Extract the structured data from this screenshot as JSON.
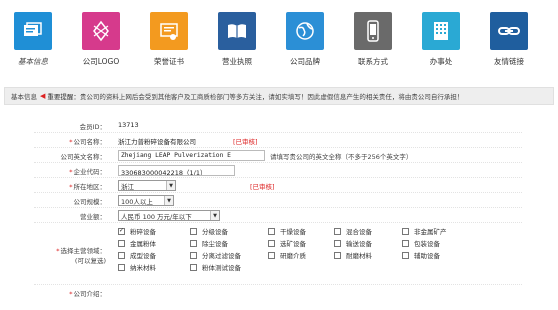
{
  "nav": [
    {
      "label": "基本信息",
      "color": "#1f8fd6",
      "icon": "profile-card-icon",
      "active": true
    },
    {
      "label": "公司LOGO",
      "color": "#d63a8c",
      "icon": "logo-shape-icon",
      "active": false
    },
    {
      "label": "荣誉证书",
      "color": "#f39a1f",
      "icon": "certificate-icon",
      "active": false
    },
    {
      "label": "营业执照",
      "color": "#2a5f9e",
      "icon": "license-book-icon",
      "active": false
    },
    {
      "label": "公司品牌",
      "color": "#2b8fd6",
      "icon": "globe-icon",
      "active": false
    },
    {
      "label": "联系方式",
      "color": "#6a6a6a",
      "icon": "phone-icon",
      "active": false
    },
    {
      "label": "办事处",
      "color": "#2aa9d4",
      "icon": "building-icon",
      "active": false
    },
    {
      "label": "友情链接",
      "color": "#1f5e9e",
      "icon": "link-icon",
      "active": false
    }
  ],
  "notice": {
    "prefix": "基本信息",
    "bold": "重要提醒：",
    "text": "贵公司的资料上网后会受到其他客户及工商质检部门等多方关注，请如实填写！因此虚假信息产生的相关责任，将由贵公司自行承担！"
  },
  "form": {
    "member_id": {
      "label": "会员ID：",
      "value": "13713"
    },
    "company_name": {
      "label": "公司名称：",
      "value": "浙江力普粉碎设备有限公司",
      "status": "[已审核]"
    },
    "english_name": {
      "label": "公司英文名称：",
      "value": "Zhejiang LEAP Pulverization E",
      "hint": "请填写贵公司的英文全称（不多于256个英文字）"
    },
    "enterprise_code": {
      "label": "企业代码：",
      "value": "330683000042218（1/1）"
    },
    "region": {
      "label": "所在地区：",
      "value": "浙江",
      "status": "[已审核]"
    },
    "scale": {
      "label": "公司规模：",
      "value": "100人以上"
    },
    "revenue": {
      "label": "营业额：",
      "value": "人民币 100 万元/年以下"
    },
    "main_industry": {
      "label": "选择主营领域：",
      "sublabel": "(可以复选)",
      "options": [
        {
          "label": "粉碎设备",
          "checked": true
        },
        {
          "label": "分级设备",
          "checked": false
        },
        {
          "label": "干燥设备",
          "checked": false
        },
        {
          "label": "混合设备",
          "checked": false
        },
        {
          "label": "非金属矿产",
          "checked": false
        },
        {
          "label": "金属粉体",
          "checked": false
        },
        {
          "label": "除尘设备",
          "checked": false
        },
        {
          "label": "选矿设备",
          "checked": false
        },
        {
          "label": "输送设备",
          "checked": false
        },
        {
          "label": "包装设备",
          "checked": false
        },
        {
          "label": "成型设备",
          "checked": false
        },
        {
          "label": "分离过滤设备",
          "checked": false
        },
        {
          "label": "研磨介质",
          "checked": false
        },
        {
          "label": "耐磨材料",
          "checked": false
        },
        {
          "label": "辅助设备",
          "checked": false
        },
        {
          "label": "纳米材料",
          "checked": false
        },
        {
          "label": "粉体测试设备",
          "checked": false
        }
      ]
    },
    "intro": {
      "label": "公司介绍："
    }
  }
}
